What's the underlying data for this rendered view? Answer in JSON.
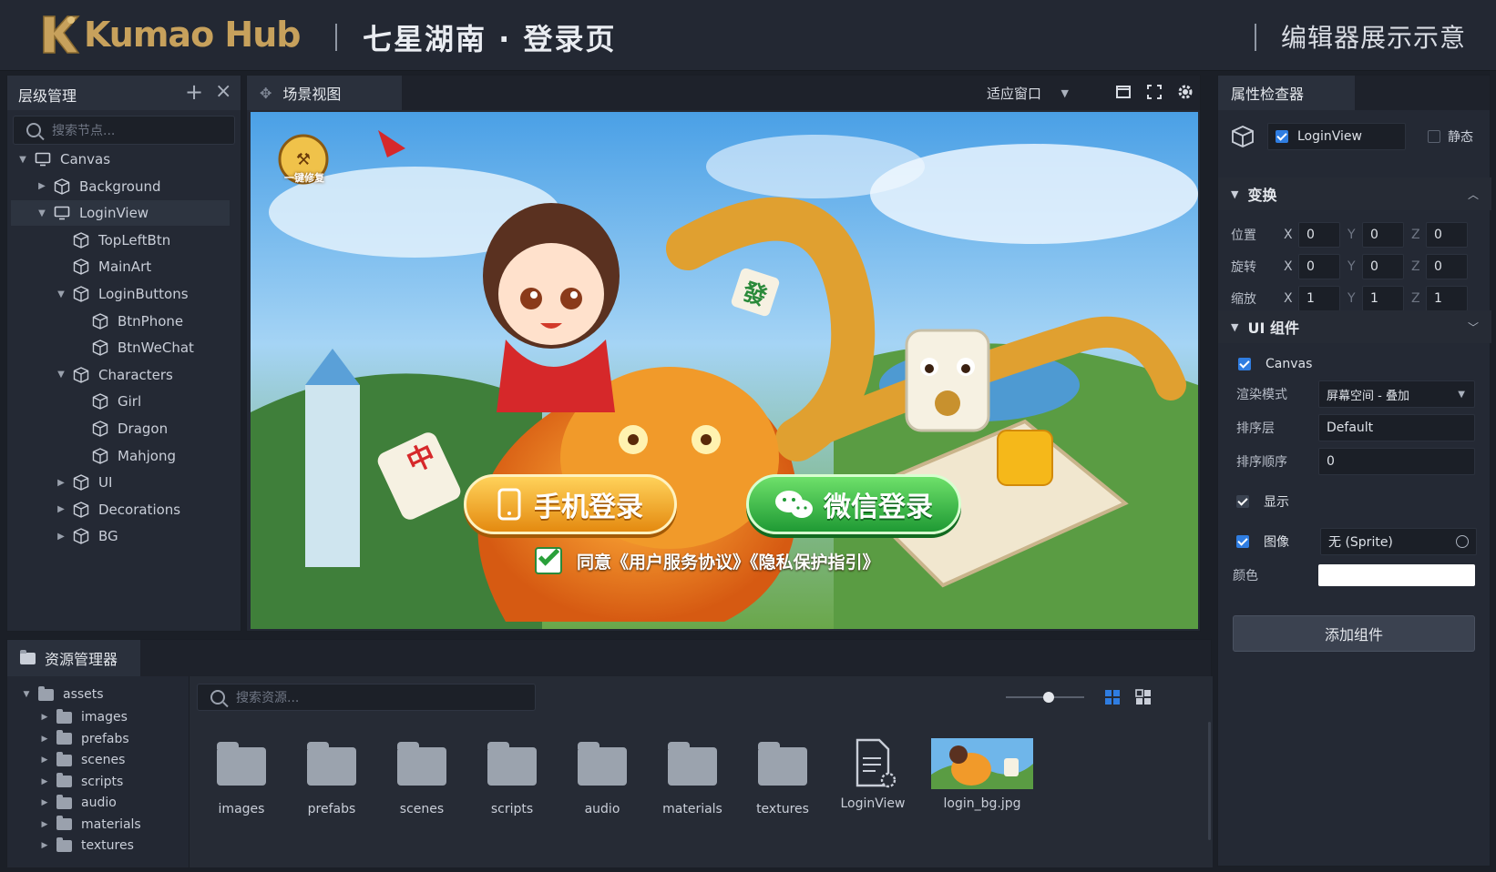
{
  "header": {
    "logo_text": "Kumao Hub",
    "page_title": "七星湖南 · 登录页",
    "demo_label": "编辑器展示示意"
  },
  "hierarchy": {
    "title": "层级管理",
    "search_placeholder": "搜索节点...",
    "nodes": [
      {
        "label": "Canvas",
        "depth": 0,
        "arrow": "▼",
        "icon": "monitor-icon"
      },
      {
        "label": "Background",
        "depth": 1,
        "arrow": "▶",
        "icon": "cube-icon"
      },
      {
        "label": "LoginView",
        "depth": 1,
        "arrow": "▼",
        "icon": "monitor-icon",
        "selected": true
      },
      {
        "label": "TopLeftBtn",
        "depth": 2,
        "arrow": "",
        "icon": "cube-icon"
      },
      {
        "label": "MainArt",
        "depth": 2,
        "arrow": "",
        "icon": "cube-icon"
      },
      {
        "label": "LoginButtons",
        "depth": 2,
        "arrow": "▼",
        "icon": "cube-icon"
      },
      {
        "label": "BtnPhone",
        "depth": 3,
        "arrow": "",
        "icon": "cube-icon"
      },
      {
        "label": "BtnWeChat",
        "depth": 3,
        "arrow": "",
        "icon": "cube-icon"
      },
      {
        "label": "Characters",
        "depth": 2,
        "arrow": "▼",
        "icon": "cube-icon"
      },
      {
        "label": "Girl",
        "depth": 3,
        "arrow": "",
        "icon": "cube-icon"
      },
      {
        "label": "Dragon",
        "depth": 3,
        "arrow": "",
        "icon": "cube-icon"
      },
      {
        "label": "Mahjong",
        "depth": 3,
        "arrow": "",
        "icon": "cube-icon"
      },
      {
        "label": "UI",
        "depth": 2,
        "arrow": "▶",
        "icon": "cube-icon"
      },
      {
        "label": "Decorations",
        "depth": 2,
        "arrow": "▶",
        "icon": "cube-icon"
      },
      {
        "label": "BG",
        "depth": 2,
        "arrow": "▶",
        "icon": "cube-icon"
      }
    ]
  },
  "scene": {
    "tab_label": "场景视图",
    "fit_option": "适应窗口",
    "game": {
      "repair_badge": "一键修复",
      "phone_login": "手机登录",
      "wechat_login": "微信登录",
      "agree_text": "同意《用户服务协议》《隐私保护指引》",
      "mahjong_tile_left": "中",
      "mahjong_tile_right": "發"
    }
  },
  "inspector": {
    "title": "属性检查器",
    "node_name": "LoginView",
    "static_label": "静态",
    "transform_title": "变换",
    "position_label": "位置",
    "rotation_label": "旋转",
    "scale_label": "缩放",
    "axis_x": "X",
    "axis_y": "Y",
    "axis_z": "Z",
    "position": [
      "0",
      "0",
      "0"
    ],
    "rotation": [
      "0",
      "0",
      "0"
    ],
    "scale": [
      "1",
      "1",
      "1"
    ],
    "ui_title": "UI 组件",
    "canvas_label": "Canvas",
    "render_mode_label": "渲染模式",
    "render_mode_value": "屏幕空间 - 叠加",
    "sort_layer_label": "排序层",
    "sort_layer_value": "Default",
    "sort_order_label": "排序顺序",
    "sort_order_value": "0",
    "display_label": "显示",
    "image_label": "图像",
    "image_value": "无 (Sprite)",
    "color_label": "颜色",
    "color_value": "#ffffff",
    "add_component": "添加组件"
  },
  "assets": {
    "title": "资源管理器",
    "search_placeholder": "搜索资源...",
    "tree_root": "assets",
    "tree_children": [
      "images",
      "prefabs",
      "scenes",
      "scripts",
      "audio",
      "materials",
      "textures"
    ],
    "items": [
      {
        "label": "images",
        "type": "folder"
      },
      {
        "label": "prefabs",
        "type": "folder"
      },
      {
        "label": "scenes",
        "type": "folder"
      },
      {
        "label": "scripts",
        "type": "folder"
      },
      {
        "label": "audio",
        "type": "folder"
      },
      {
        "label": "materials",
        "type": "folder"
      },
      {
        "label": "textures",
        "type": "folder"
      },
      {
        "label": "LoginView",
        "type": "scene-file"
      },
      {
        "label": "login_bg.jpg",
        "type": "image"
      }
    ],
    "thumbnail_size": 0.55
  },
  "colors": {
    "accent": "#2f7de1",
    "logo_gold": "#c7a15c",
    "phone_button": "#f0a21c",
    "wechat_button": "#36b24a"
  }
}
